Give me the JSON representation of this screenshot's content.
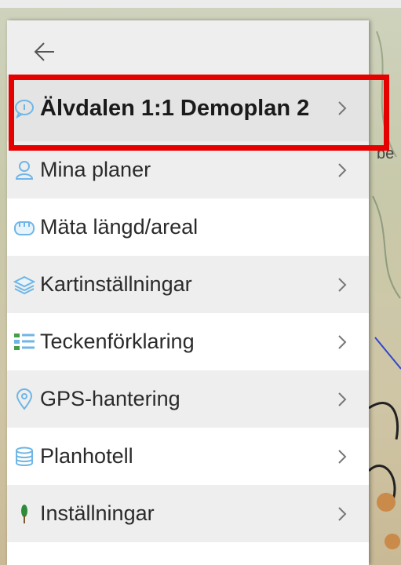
{
  "drawer": {
    "back_label": "←",
    "items": [
      {
        "label": "Älvdalen 1:1 Demoplan 2",
        "icon": "plan-info-icon",
        "has_chevron": true,
        "selected": true
      },
      {
        "label": "Mina planer",
        "icon": "person-icon",
        "has_chevron": true
      },
      {
        "label": "Mäta längd/areal",
        "icon": "measure-icon",
        "has_chevron": false
      },
      {
        "label": "Kartinställningar",
        "icon": "layers-icon",
        "has_chevron": true
      },
      {
        "label": "Teckenförklaring",
        "icon": "legend-icon",
        "has_chevron": true
      },
      {
        "label": "GPS-hantering",
        "icon": "location-pin-icon",
        "has_chevron": true
      },
      {
        "label": "Planhotell",
        "icon": "database-icon",
        "has_chevron": true
      },
      {
        "label": "Inställningar",
        "icon": "tree-icon",
        "has_chevron": true
      }
    ]
  },
  "map": {
    "edge_text": "be"
  },
  "colors": {
    "icon_blue": "#6fb6e6",
    "highlight": "#e60000",
    "legend_green": "#43a047"
  }
}
